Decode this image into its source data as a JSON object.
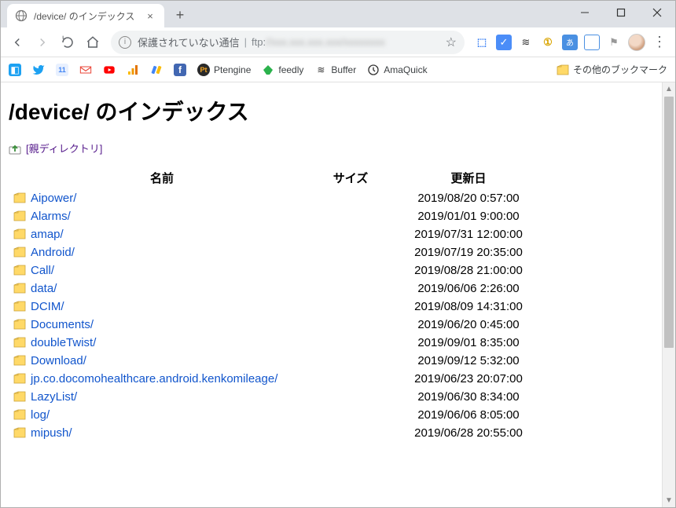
{
  "tab": {
    "title": "/device/ のインデックス"
  },
  "omnibox": {
    "warning": "保護されていない通信",
    "scheme": "ftp:"
  },
  "bookmarks_overflow": "その他のブックマーク",
  "bm_items": [
    {
      "label": "Ptengine"
    },
    {
      "label": "feedly"
    },
    {
      "label": "Buffer"
    },
    {
      "label": "AmaQuick"
    }
  ],
  "page": {
    "heading": "/device/ のインデックス",
    "parent_label": "[親ディレクトリ]",
    "columns": {
      "name": "名前",
      "size": "サイズ",
      "date": "更新日"
    },
    "rows": [
      {
        "name": "Aipower/",
        "date": "2019/08/20 0:57:00"
      },
      {
        "name": "Alarms/",
        "date": "2019/01/01 9:00:00"
      },
      {
        "name": "amap/",
        "date": "2019/07/31 12:00:00"
      },
      {
        "name": "Android/",
        "date": "2019/07/19 20:35:00"
      },
      {
        "name": "Call/",
        "date": "2019/08/28 21:00:00"
      },
      {
        "name": "data/",
        "date": "2019/06/06 2:26:00"
      },
      {
        "name": "DCIM/",
        "date": "2019/08/09 14:31:00"
      },
      {
        "name": "Documents/",
        "date": "2019/06/20 0:45:00"
      },
      {
        "name": "doubleTwist/",
        "date": "2019/09/01 8:35:00"
      },
      {
        "name": "Download/",
        "date": "2019/09/12 5:32:00"
      },
      {
        "name": "jp.co.docomohealthcare.android.kenkomileage/",
        "date": "2019/06/23 20:07:00"
      },
      {
        "name": "LazyList/",
        "date": "2019/06/30 8:34:00"
      },
      {
        "name": "log/",
        "date": "2019/06/06 8:05:00"
      },
      {
        "name": "mipush/",
        "date": "2019/06/28 20:55:00"
      }
    ]
  }
}
